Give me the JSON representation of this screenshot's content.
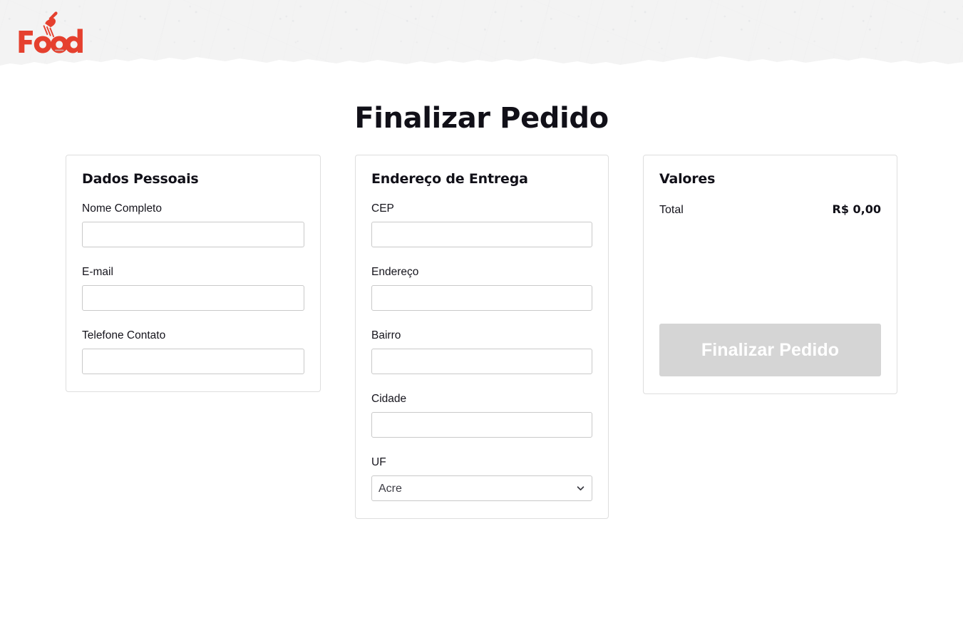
{
  "header": {
    "logo_text": "Food",
    "logo_icon": "fork-icon",
    "brand_color": "#e5402e"
  },
  "page_title": "Finalizar Pedido",
  "cards": {
    "personal": {
      "title": "Dados Pessoais",
      "fields": [
        {
          "label": "Nome Completo",
          "value": "",
          "placeholder": "",
          "type": "text",
          "name": "full-name"
        },
        {
          "label": "E-mail",
          "value": "",
          "placeholder": "",
          "type": "text",
          "name": "email"
        },
        {
          "label": "Telefone Contato",
          "value": "",
          "placeholder": "",
          "type": "text",
          "name": "phone"
        }
      ]
    },
    "address": {
      "title": "Endereço de Entrega",
      "fields": [
        {
          "label": "CEP",
          "value": "",
          "placeholder": "",
          "type": "text",
          "name": "cep"
        },
        {
          "label": "Endereço",
          "value": "",
          "placeholder": "",
          "type": "text",
          "name": "street"
        },
        {
          "label": "Bairro",
          "value": "",
          "placeholder": "",
          "type": "text",
          "name": "district"
        },
        {
          "label": "Cidade",
          "value": "",
          "placeholder": "",
          "type": "text",
          "name": "city"
        }
      ],
      "uf": {
        "label": "UF",
        "selected": "Acre",
        "chevron_icon": "chevron-down-icon",
        "options": [
          "Acre"
        ]
      }
    },
    "values": {
      "title": "Valores",
      "total_label": "Total",
      "total_amount": "R$ 0,00",
      "submit_label": "Finalizar Pedido",
      "submit_disabled": true,
      "submit_bg_color": "#d5d5d5"
    }
  }
}
